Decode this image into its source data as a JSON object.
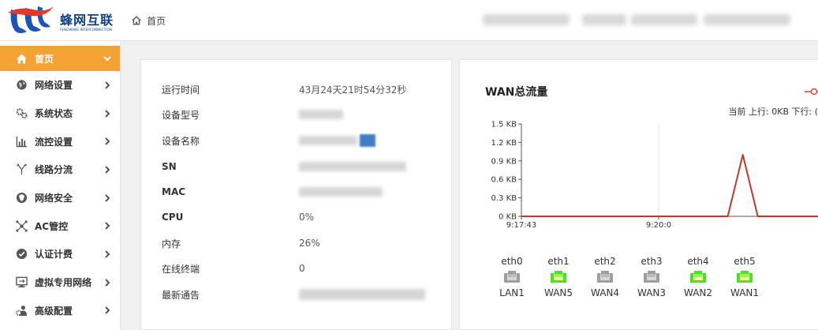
{
  "brand": {
    "name_cn": "蜂网互联",
    "name_en": "FENGWANG INTERCONNECTION"
  },
  "breadcrumb": {
    "home_icon": "home-icon",
    "label": "首页"
  },
  "sidebar": {
    "accent_color": "#f4a233",
    "items": [
      {
        "label": "首页",
        "icon": "home-icon",
        "active": true
      },
      {
        "label": "网络设置",
        "icon": "globe-icon"
      },
      {
        "label": "系统状态",
        "icon": "gears-icon"
      },
      {
        "label": "流控设置",
        "icon": "bar-chart-icon"
      },
      {
        "label": "线路分流",
        "icon": "fork-icon"
      },
      {
        "label": "网络安全",
        "icon": "shield-icon"
      },
      {
        "label": "AC管控",
        "icon": "network-icon"
      },
      {
        "label": "认证计费",
        "icon": "check-badge-icon"
      },
      {
        "label": "虚拟专用网络",
        "icon": "monitor-icon"
      },
      {
        "label": "高级配置",
        "icon": "user-gear-icon"
      }
    ]
  },
  "info": {
    "uptime": {
      "label": "运行时间",
      "value": "43月24天21时54分32秒"
    },
    "model": {
      "label": "设备型号"
    },
    "name": {
      "label": "设备名称"
    },
    "sn": {
      "label": "SN"
    },
    "mac": {
      "label": "MAC"
    },
    "cpu": {
      "label": "CPU",
      "value": "0%"
    },
    "memory": {
      "label": "内存",
      "value": "26%"
    },
    "clients": {
      "label": "在线终端",
      "value": "0"
    },
    "notice": {
      "label": "最新通告"
    }
  },
  "wan": {
    "title": "WAN总流量",
    "summary": "当前  上行: 0KB  下行: (",
    "chart_data": {
      "type": "line",
      "x_tick_labels": [
        "9:17:43",
        "9:20:0"
      ],
      "y_tick_labels": [
        "0 KB",
        "0.3 KB",
        "0.6 KB",
        "0.9 KB",
        "1.2 KB",
        "1.5 KB"
      ],
      "ylim": [
        0,
        1.5
      ],
      "series": [
        {
          "color": "#c0392b",
          "points": [
            {
              "x": "9:17:43",
              "y": 0
            },
            {
              "x": "9:21:09",
              "y": 0
            },
            {
              "x": "9:21:24",
              "y": 1.0
            },
            {
              "x": "9:21:39",
              "y": 0
            },
            {
              "x": "9:23:42",
              "y": 0
            }
          ]
        }
      ],
      "grid": "vertical"
    },
    "ports": [
      {
        "name": "eth0",
        "label": "LAN1",
        "up": false
      },
      {
        "name": "eth1",
        "label": "WAN5",
        "up": true
      },
      {
        "name": "eth2",
        "label": "WAN4",
        "up": false
      },
      {
        "name": "eth3",
        "label": "WAN3",
        "up": false
      },
      {
        "name": "eth4",
        "label": "WAN2",
        "up": true
      },
      {
        "name": "eth5",
        "label": "WAN1",
        "up": true
      }
    ],
    "port_up_color": "#46e61e",
    "port_down_color": "#9e9e9e"
  }
}
